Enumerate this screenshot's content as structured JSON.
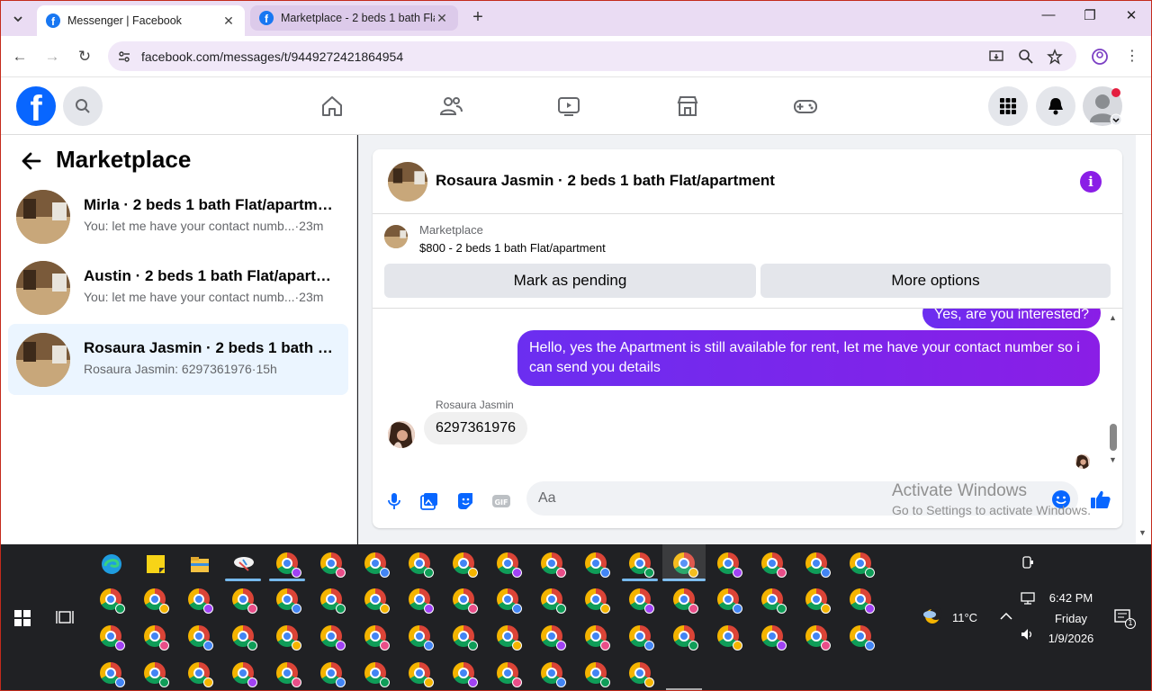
{
  "browser": {
    "tabs": [
      {
        "title": "Messenger | Facebook",
        "active": true
      },
      {
        "title": "Marketplace - 2 beds 1 bath Flat/apartment",
        "active": false
      }
    ],
    "url": "facebook.com/messages/t/9449272421864954"
  },
  "sidebar": {
    "title": "Marketplace",
    "conversations": [
      {
        "name": "Mirla · 2 beds 1 bath Flat/apartment",
        "snippet": "You: let me have your contact numb...",
        "time": "·23m"
      },
      {
        "name": "Austin · 2 beds 1 bath Flat/apartm...",
        "snippet": "You: let me have your contact numb...",
        "time": "·23m"
      },
      {
        "name": "Rosaura Jasmin · 2 beds 1 bath Flat...",
        "snippet": "Rosaura Jasmin: 6297361976",
        "time": "·15h",
        "selected": true
      }
    ]
  },
  "chat": {
    "title": "Rosaura Jasmin · 2 beds 1 bath Flat/apartment",
    "listing_label": "Marketplace",
    "listing_price": "$800 - 2 beds 1 bath Flat/apartment",
    "mark_pending": "Mark as pending",
    "more_options": "More options",
    "messages": [
      {
        "from": "me",
        "text": "Yes, are you interested?"
      },
      {
        "from": "me",
        "text": "Hello, yes the Apartment is still available for rent, let me have your contact number so i can send you details"
      },
      {
        "from": "Rosaura Jasmin",
        "sender_label": "Rosaura Jasmin",
        "text": "6297361976"
      }
    ],
    "composer_placeholder": "Aa"
  },
  "watermark": {
    "line1": "Activate Windows",
    "line2": "Go to Settings to activate Windows."
  },
  "system": {
    "temp": "11°C",
    "time": "6:42 PM",
    "day": "Friday",
    "date": "1/9/2026",
    "notif_count": "1"
  },
  "colors": {
    "brand": "#0866ff",
    "accent_purple": "#8a1ee6",
    "selected_bg": "#ebf5ff"
  }
}
